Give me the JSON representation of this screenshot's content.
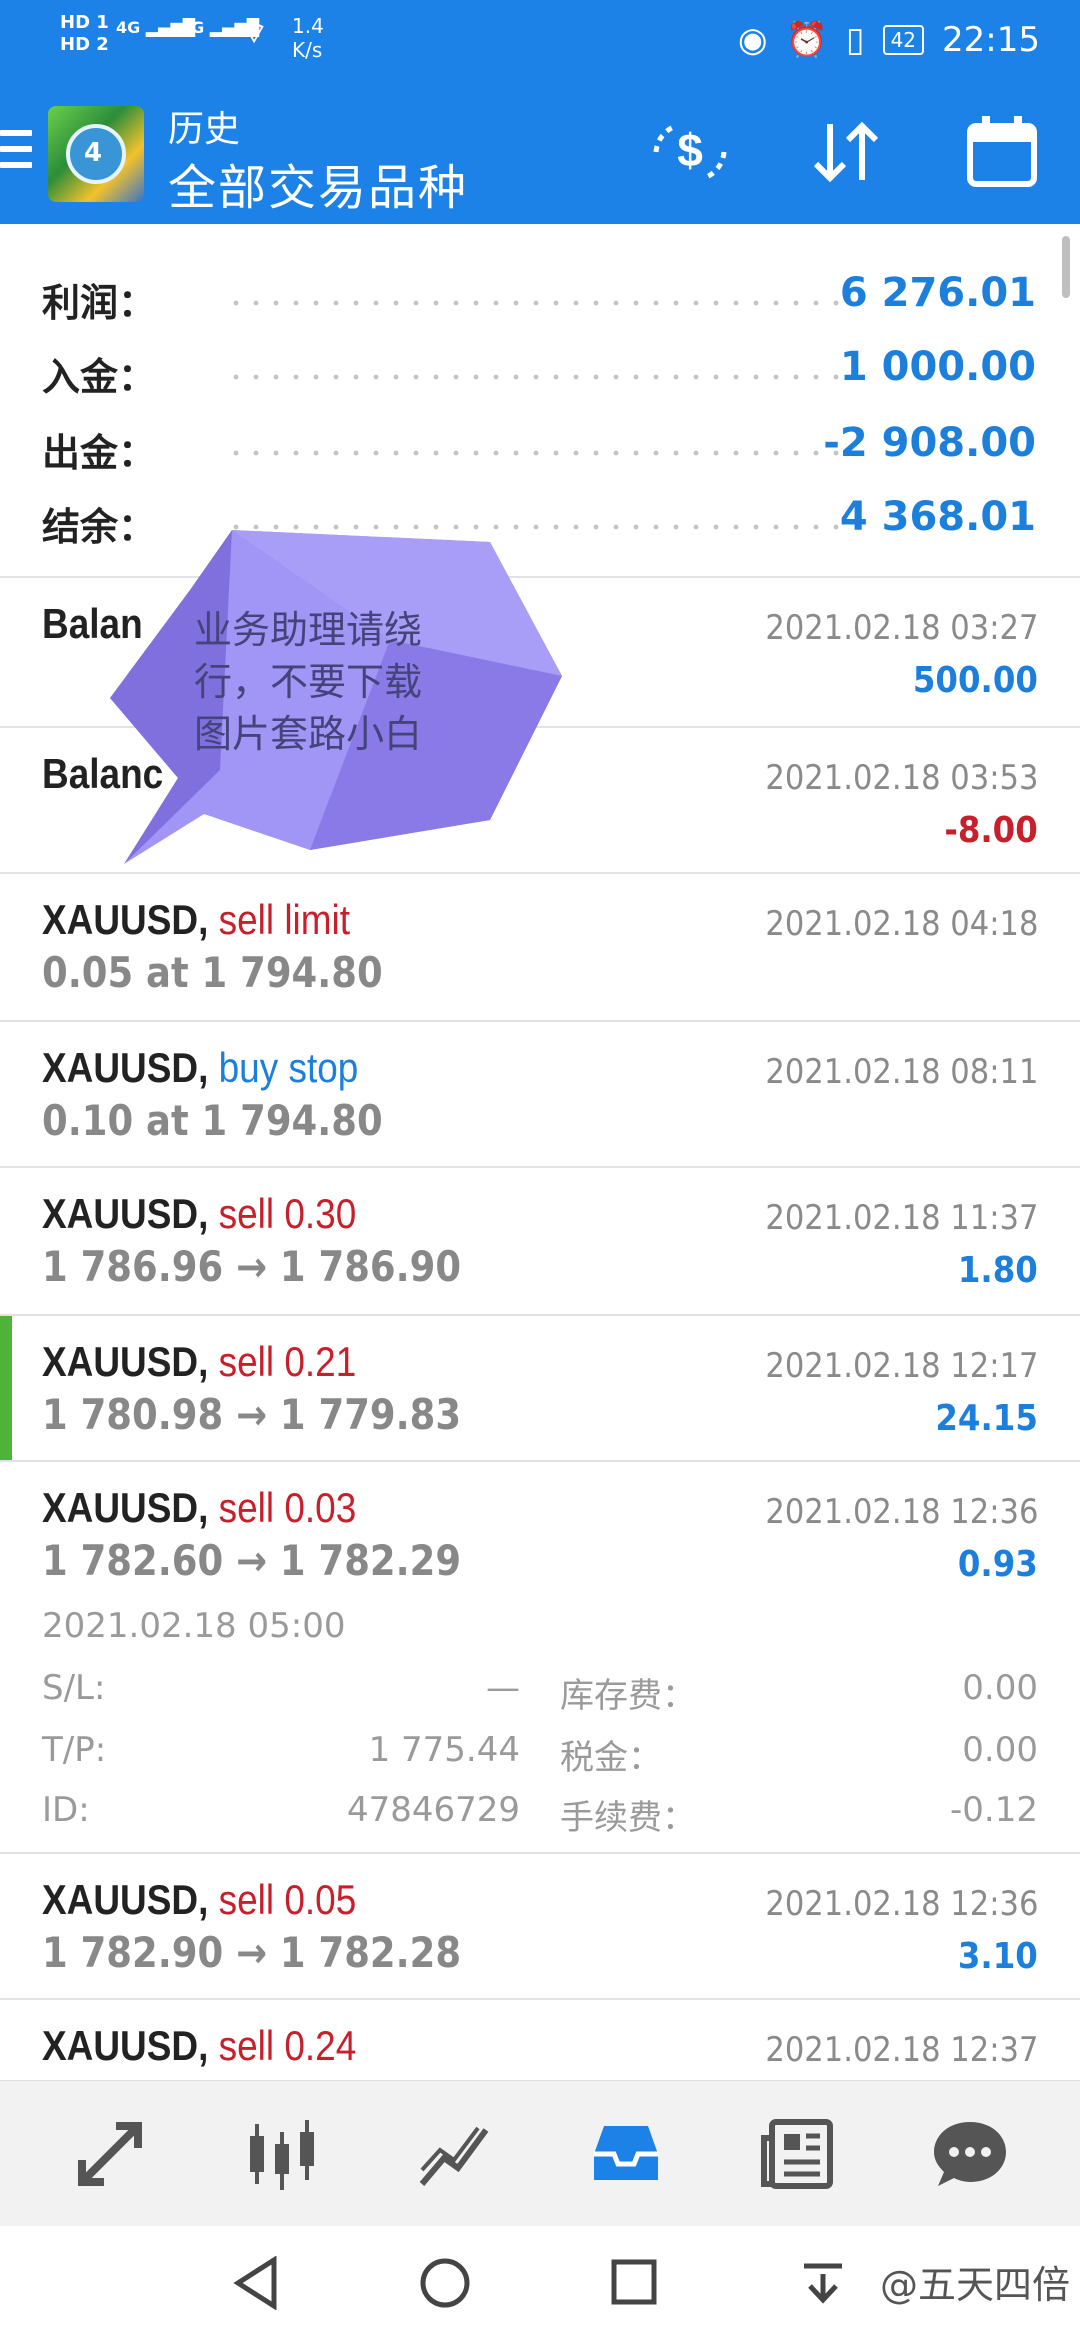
{
  "status_bar": {
    "network_1": "HD 1",
    "network_2": "HD 2",
    "signal_1": "4G",
    "signal_2": "4G",
    "speed_value": "1.4",
    "speed_unit": "K/s",
    "battery": "42",
    "clock": "22:15"
  },
  "app_bar": {
    "title": "历史",
    "subtitle": "全部交易品种",
    "icons": [
      "menu-icon",
      "app-logo-icon",
      "currency-exchange-icon",
      "sort-icon",
      "calendar-icon"
    ],
    "accent_color": "#1c82e8"
  },
  "summary": {
    "profit_label": "利润：",
    "profit_value": "6 276.01",
    "deposit_label": "入金：",
    "deposit_value": "1 000.00",
    "withdrawal_label": "出金：",
    "withdrawal_value": "-2 908.00",
    "balance_label": "结余：",
    "balance_value": "4 368.01"
  },
  "overlay": {
    "line1": "业务助理请绕",
    "line2": "行，不要下载",
    "line3": "图片套路小白"
  },
  "deals": [
    {
      "symbol": "Balan",
      "action": "",
      "sub": "",
      "time": "2021.02.18 03:27",
      "profit": "500.00"
    },
    {
      "symbol": "Balanc",
      "action": "",
      "sub": "",
      "time": "2021.02.18 03:53",
      "profit": "-8.00"
    },
    {
      "symbol": "XAUUSD, ",
      "action": "sell limit",
      "sub": "0.05 at 1 794.80",
      "time": "2021.02.18 04:18",
      "profit": ""
    },
    {
      "symbol": "XAUUSD, ",
      "action": "buy stop",
      "sub": "0.10 at 1 794.80",
      "time": "2021.02.18 08:11",
      "profit": ""
    },
    {
      "symbol": "XAUUSD, ",
      "action": "sell 0.30",
      "sub": "1 786.96 → 1 786.90",
      "time": "2021.02.18 11:37",
      "profit": "1.80"
    },
    {
      "symbol": "XAUUSD, ",
      "action": "sell 0.21",
      "sub": "1 780.98 → 1 779.83",
      "time": "2021.02.18 12:17",
      "profit": "24.15"
    },
    {
      "symbol": "XAUUSD, ",
      "action": "sell 0.03",
      "sub": "1 782.60 → 1 782.29",
      "time": "2021.02.18 12:36",
      "profit": "0.93"
    },
    {
      "symbol": "XAUUSD, ",
      "action": "sell 0.05",
      "sub": "1 782.90 → 1 782.28",
      "time": "2021.02.18 12:36",
      "profit": "3.10"
    },
    {
      "symbol": "XAUUSD, ",
      "action": "sell 0.24",
      "sub": "",
      "time": "2021.02.18 12:37",
      "profit": ""
    }
  ],
  "expanded": {
    "open_time": "2021.02.18 05:00",
    "sl_label": "S/L:",
    "sl_value": "—",
    "tp_label": "T/P:",
    "tp_value": "1 775.44",
    "id_label": "ID:",
    "id_value": "47846729",
    "swap_label": "库存费：",
    "swap_value": "0.00",
    "tax_label": "税金：",
    "tax_value": "0.00",
    "commission_label": "手续费：",
    "commission_value": "-0.12"
  },
  "tabs": [
    "trade-icon",
    "quotes-icon",
    "chart-icon",
    "history-icon",
    "news-icon",
    "chat-icon"
  ],
  "active_tab": "history-icon",
  "watermark": "@五天四倍",
  "colors": {
    "profit_blue": "#1c7fdc",
    "sell_red": "#c8202a",
    "accent_green": "#4fb33a"
  }
}
